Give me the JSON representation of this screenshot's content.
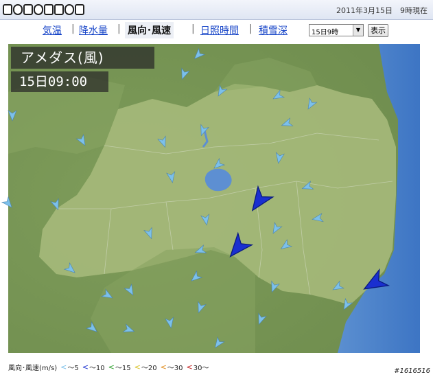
{
  "header": {
    "logo_text": "福島県ルート情報",
    "datetime": "2011年3月15日　9時現在"
  },
  "nav": {
    "tabs": [
      {
        "label": "気温"
      },
      {
        "label": "降水量"
      },
      {
        "label": "風向･風速"
      },
      {
        "label": "日照時間"
      },
      {
        "label": "積雪深"
      }
    ],
    "active_tab": "風向･風速",
    "time_select_value": "15日9時",
    "submit_label": "表示"
  },
  "map": {
    "title": "アメダス(風)",
    "time_label": "15日09:00"
  },
  "legend": {
    "label": "風向･風速(m/s)",
    "items": [
      {
        "label": "〜5",
        "color": "#7cc0ea"
      },
      {
        "label": "〜10",
        "color": "#1a2fd0"
      },
      {
        "label": "〜15",
        "color": "#2a9e2a"
      },
      {
        "label": "〜20",
        "color": "#d8c020"
      },
      {
        "label": "〜30",
        "color": "#e08a18"
      },
      {
        "label": "30〜",
        "color": "#c01818"
      }
    ]
  },
  "image_id": "#1616516"
}
